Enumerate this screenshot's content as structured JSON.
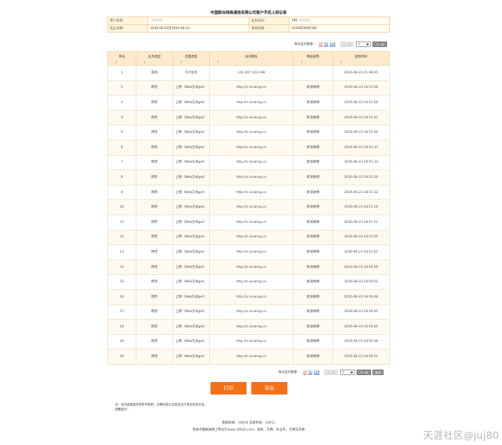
{
  "title": "中国联合网络通信有限公司客户手机上网记录",
  "info": {
    "customer_name_label": "客户名称：",
    "customer_name_value": "",
    "business_no_label": "业务号码：",
    "business_no_value": "185",
    "period_label": "起止日期：",
    "period_value": "2016-06-22至2016-06-23",
    "query_date_label": "查询日期：",
    "query_date_value": "2016年06月23日"
  },
  "pager": {
    "per_page_label": "每页显示数量：",
    "sizes": [
      "20",
      "50",
      "100"
    ],
    "prev_label": "上一页",
    "page_value": "1",
    "next_label": "下一页",
    "last_label": "尾页"
  },
  "table": {
    "headers": [
      "序号",
      "业务类型",
      "流量类型",
      "访问网址",
      "网站名称",
      "起始时间"
    ],
    "sort_icon": "⇕",
    "rows": [
      {
        "no": "1",
        "biz": "其他",
        "traffic": "TCP业务",
        "url": "140.207.123.199",
        "site": "",
        "time": "2016-06-23 21:38:45"
      },
      {
        "no": "2",
        "biz": "网页",
        "traffic": "上网（Web方式get）",
        "url": "http://n.sinaimg.cn",
        "site": "新浪微博",
        "time": "2016-06-23 18:51:56"
      },
      {
        "no": "3",
        "biz": "网页",
        "traffic": "上网（Web方式get）",
        "url": "http://n.sinaimg.cn",
        "site": "新浪微博",
        "time": "2016-06-23 18:51:50"
      },
      {
        "no": "4",
        "biz": "网页",
        "traffic": "上网（Web方式get）",
        "url": "http://n.sinaimg.cn",
        "site": "新浪微博",
        "time": "2016-06-23 18:51:45"
      },
      {
        "no": "5",
        "biz": "网页",
        "traffic": "上网（Web方式get）",
        "url": "http://n.sinaimg.cn",
        "site": "新浪微博",
        "time": "2016-06-23 18:51:40"
      },
      {
        "no": "6",
        "biz": "网页",
        "traffic": "上网（Web方式get）",
        "url": "http://n.sinaimg.cn",
        "site": "新浪微博",
        "time": "2016-06-23 18:51:37"
      },
      {
        "no": "7",
        "biz": "网页",
        "traffic": "上网（Web方式get）",
        "url": "http://n.sinaimg.cn",
        "site": "新浪微博",
        "time": "2016-06-23 18:51:33"
      },
      {
        "no": "8",
        "biz": "网页",
        "traffic": "上网（Web方式get）",
        "url": "http://n.sinaimg.cn",
        "site": "新浪微博",
        "time": "2016-06-23 18:51:26"
      },
      {
        "no": "9",
        "biz": "网页",
        "traffic": "上网（Web方式get）",
        "url": "http://n.sinaimg.cn",
        "site": "新浪微博",
        "time": "2016-06-23 18:51:22"
      },
      {
        "no": "10",
        "biz": "网页",
        "traffic": "上网（Web方式get）",
        "url": "http://n.sinaimg.cn",
        "site": "新浪微博",
        "time": "2016-06-23 18:51:18"
      },
      {
        "no": "11",
        "biz": "网页",
        "traffic": "上网（Web方式get）",
        "url": "http://n.sinaimg.cn",
        "site": "新浪微博",
        "time": "2016-06-23 18:51:12"
      },
      {
        "no": "12",
        "biz": "网页",
        "traffic": "上网（Web方式get）",
        "url": "http://n.sinaimg.cn",
        "site": "新浪微博",
        "time": "2016-06-23 18:51:05"
      },
      {
        "no": "13",
        "biz": "网页",
        "traffic": "上网（Web方式get）",
        "url": "http://n.sinaimg.cn",
        "site": "新浪微博",
        "time": "2016-06-23 18:51:01"
      },
      {
        "no": "14",
        "biz": "网页",
        "traffic": "上网（Web方式get）",
        "url": "http://n.sinaimg.cn",
        "site": "新浪微博",
        "time": "2016-06-23 18:50:56"
      },
      {
        "no": "15",
        "biz": "网页",
        "traffic": "上网（Web方式get）",
        "url": "http://n.sinaimg.cn",
        "site": "新浪微博",
        "time": "2016-06-23 18:50:52"
      },
      {
        "no": "16",
        "biz": "网页",
        "traffic": "上网（Web方式get）",
        "url": "http://n.sinaimg.cn",
        "site": "新浪微博",
        "time": "2016-06-23 18:50:48"
      },
      {
        "no": "17",
        "biz": "网页",
        "traffic": "上网（Web方式get）",
        "url": "http://n.sinaimg.cn",
        "site": "新浪微博",
        "time": "2016-06-23 18:50:45"
      },
      {
        "no": "18",
        "biz": "网页",
        "traffic": "上网（Web方式get）",
        "url": "http://n.sinaimg.cn",
        "site": "新浪微博",
        "time": "2016-06-23 18:50:40"
      },
      {
        "no": "19",
        "biz": "网页",
        "traffic": "上网（Web方式get）",
        "url": "http://n.sinaimg.cn",
        "site": "新浪微博",
        "time": "2016-06-23 18:50:36"
      },
      {
        "no": "20",
        "biz": "网页",
        "traffic": "上网（Web方式get）",
        "url": "http://n.sinaimg.cn",
        "site": "新浪微博",
        "time": "2016-06-23 18:50:32"
      }
    ]
  },
  "buttons": {
    "print_label": "打印",
    "export_label": "导出"
  },
  "notes": {
    "line1": "注：本页面数据仅供参考使用，详细内容以当地营业厅查询内容为准。",
    "line2": "温馨提示："
  },
  "footer": {
    "line1": "客服热线：10010  充值专线：10011",
    "line2": "登录中国联通网上营业厅www.10010.com，查询、交费、办业务，方便又实惠"
  },
  "watermark": "天涯社区@juj80",
  "colors": {
    "accent_orange": "#f36f18",
    "header_bg": "#fdeacd",
    "active_page_size": "#e2321e"
  }
}
